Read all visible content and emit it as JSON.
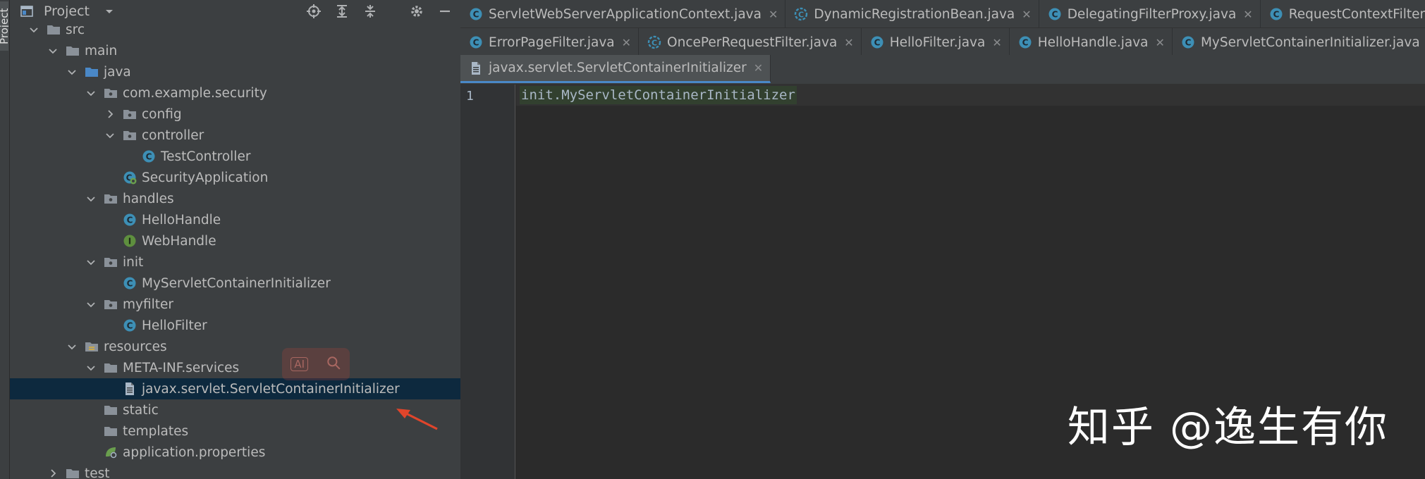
{
  "side_strip": {
    "label": "Project"
  },
  "panel": {
    "title": "Project",
    "tree": [
      {
        "label": "src",
        "kind": "folder",
        "depth": 0,
        "expanded": true
      },
      {
        "label": "main",
        "kind": "folder",
        "depth": 1,
        "expanded": true
      },
      {
        "label": "java",
        "kind": "folder-src",
        "depth": 2,
        "expanded": true
      },
      {
        "label": "com.example.security",
        "kind": "package",
        "depth": 3,
        "expanded": true
      },
      {
        "label": "config",
        "kind": "package",
        "depth": 4,
        "expanded": false
      },
      {
        "label": "controller",
        "kind": "package",
        "depth": 4,
        "expanded": true
      },
      {
        "label": "TestController",
        "kind": "class",
        "depth": 5
      },
      {
        "label": "SecurityApplication",
        "kind": "spring-class",
        "depth": 4
      },
      {
        "label": "handles",
        "kind": "package",
        "depth": 3,
        "expanded": true
      },
      {
        "label": "HelloHandle",
        "kind": "class",
        "depth": 4
      },
      {
        "label": "WebHandle",
        "kind": "interface",
        "depth": 4
      },
      {
        "label": "init",
        "kind": "package",
        "depth": 3,
        "expanded": true
      },
      {
        "label": "MyServletContainerInitializer",
        "kind": "class",
        "depth": 4
      },
      {
        "label": "myfilter",
        "kind": "package",
        "depth": 3,
        "expanded": true
      },
      {
        "label": "HelloFilter",
        "kind": "class",
        "depth": 4
      },
      {
        "label": "resources",
        "kind": "folder-res",
        "depth": 2,
        "expanded": true
      },
      {
        "label": "META-INF.services",
        "kind": "folder",
        "depth": 3,
        "expanded": true
      },
      {
        "label": "javax.servlet.ServletContainerInitializer",
        "kind": "file",
        "depth": 4,
        "selected": true
      },
      {
        "label": "static",
        "kind": "folder",
        "depth": 3
      },
      {
        "label": "templates",
        "kind": "folder",
        "depth": 3
      },
      {
        "label": "application.properties",
        "kind": "properties",
        "depth": 3
      },
      {
        "label": "test",
        "kind": "folder",
        "depth": 1,
        "expanded": false
      }
    ]
  },
  "editor": {
    "tab_rows": [
      [
        {
          "label": "ServletWebServerApplicationContext.java",
          "kind": "class"
        },
        {
          "label": "DynamicRegistrationBean.java",
          "kind": "abstract"
        },
        {
          "label": "DelegatingFilterProxy.java",
          "kind": "class"
        },
        {
          "label": "RequestContextFilter.java",
          "kind": "class"
        }
      ],
      [
        {
          "label": "ErrorPageFilter.java",
          "kind": "class"
        },
        {
          "label": "OncePerRequestFilter.java",
          "kind": "abstract"
        },
        {
          "label": "HelloFilter.java",
          "kind": "class"
        },
        {
          "label": "HelloHandle.java",
          "kind": "class"
        },
        {
          "label": "MyServletContainerInitializer.java",
          "kind": "class"
        }
      ],
      [
        {
          "label": "javax.servlet.ServletContainerInitializer",
          "kind": "file",
          "active": true
        }
      ]
    ],
    "line_number": "1",
    "code_line": "init.MyServletContainerInitializer"
  },
  "overlay": {
    "ai_label": "AI"
  },
  "watermark": "知乎 @逸生有你",
  "colors": {
    "class_icon": "#3d8fb5",
    "interface_icon": "#5e8f3e",
    "folder_icon": "#8a9199",
    "selection": "#0d293e",
    "arrow": "#e0452b"
  }
}
